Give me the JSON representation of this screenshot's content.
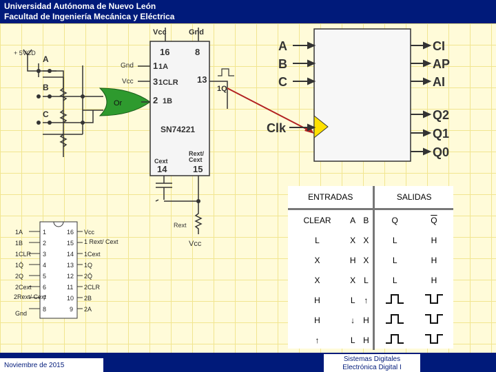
{
  "header": {
    "line1": "Universidad Autónoma de Nuevo León",
    "line2": "Facultad de Ingeniería Mecánica y Eléctrica"
  },
  "footer": {
    "date": "Noviembre de 2015",
    "course1": "Sistemas Digitales",
    "course2": "Electrónica Digital I"
  },
  "circuit": {
    "supply": "+ 5VCD",
    "switch_a": "A",
    "switch_b": "B",
    "switch_c": "C",
    "gate": "Or",
    "gnd_label": "Gnd",
    "vcc_label": "Vcc",
    "chip": {
      "top_vcc": "Vcc",
      "top_gnd": "Gnd",
      "pin16": "16",
      "pin8": "8",
      "pin1": "1",
      "pin1_name": "1A",
      "pin3": "3",
      "pin3_name": "1CLR",
      "pin2": "2",
      "pin2_name": "1B",
      "pin13": "13",
      "pin13_name": "1Q",
      "part": "SN74221",
      "cext": "Cext",
      "rext": "Rext/",
      "rext2": "Cext",
      "pin14": "14",
      "pin15": "15"
    },
    "rext_label": "Rext",
    "vcc_bottom": "Vcc"
  },
  "block": {
    "inputs": [
      "A",
      "B",
      "C"
    ],
    "clk": "Clk",
    "outputs": [
      "CI",
      "AP",
      "AI",
      "Q2",
      "Q1",
      "Q0"
    ]
  },
  "pinout": {
    "left_names": [
      "1A",
      "1B",
      "1CLR",
      "1Q̄",
      "2Q",
      "2Cext",
      "2Rext/ Cext",
      "Gnd"
    ],
    "left_nums": [
      "1",
      "2",
      "3",
      "4",
      "5",
      "6",
      "7",
      "8"
    ],
    "right_nums": [
      "16",
      "15",
      "14",
      "13",
      "12",
      "11",
      "10",
      "9"
    ],
    "right_names": [
      "Vcc",
      "1 Rext/ Cext",
      "1Cext",
      "1Q",
      "2Q̄",
      "2CLR",
      "2B",
      "2A"
    ]
  },
  "truth_table": {
    "group_inputs": "ENTRADAS",
    "group_outputs": "SALIDAS",
    "columns": [
      "CLEAR",
      "A",
      "B",
      "Q",
      "Q"
    ],
    "rows": [
      [
        "L",
        "X",
        "X",
        "L",
        "H"
      ],
      [
        "X",
        "H",
        "X",
        "L",
        "H"
      ],
      [
        "X",
        "X",
        "L",
        "L",
        "H"
      ],
      [
        "H",
        "L",
        "↑",
        "",
        ""
      ],
      [
        "H",
        "↓",
        "H",
        "",
        ""
      ],
      [
        "↑",
        "L",
        "H",
        "",
        ""
      ]
    ]
  }
}
